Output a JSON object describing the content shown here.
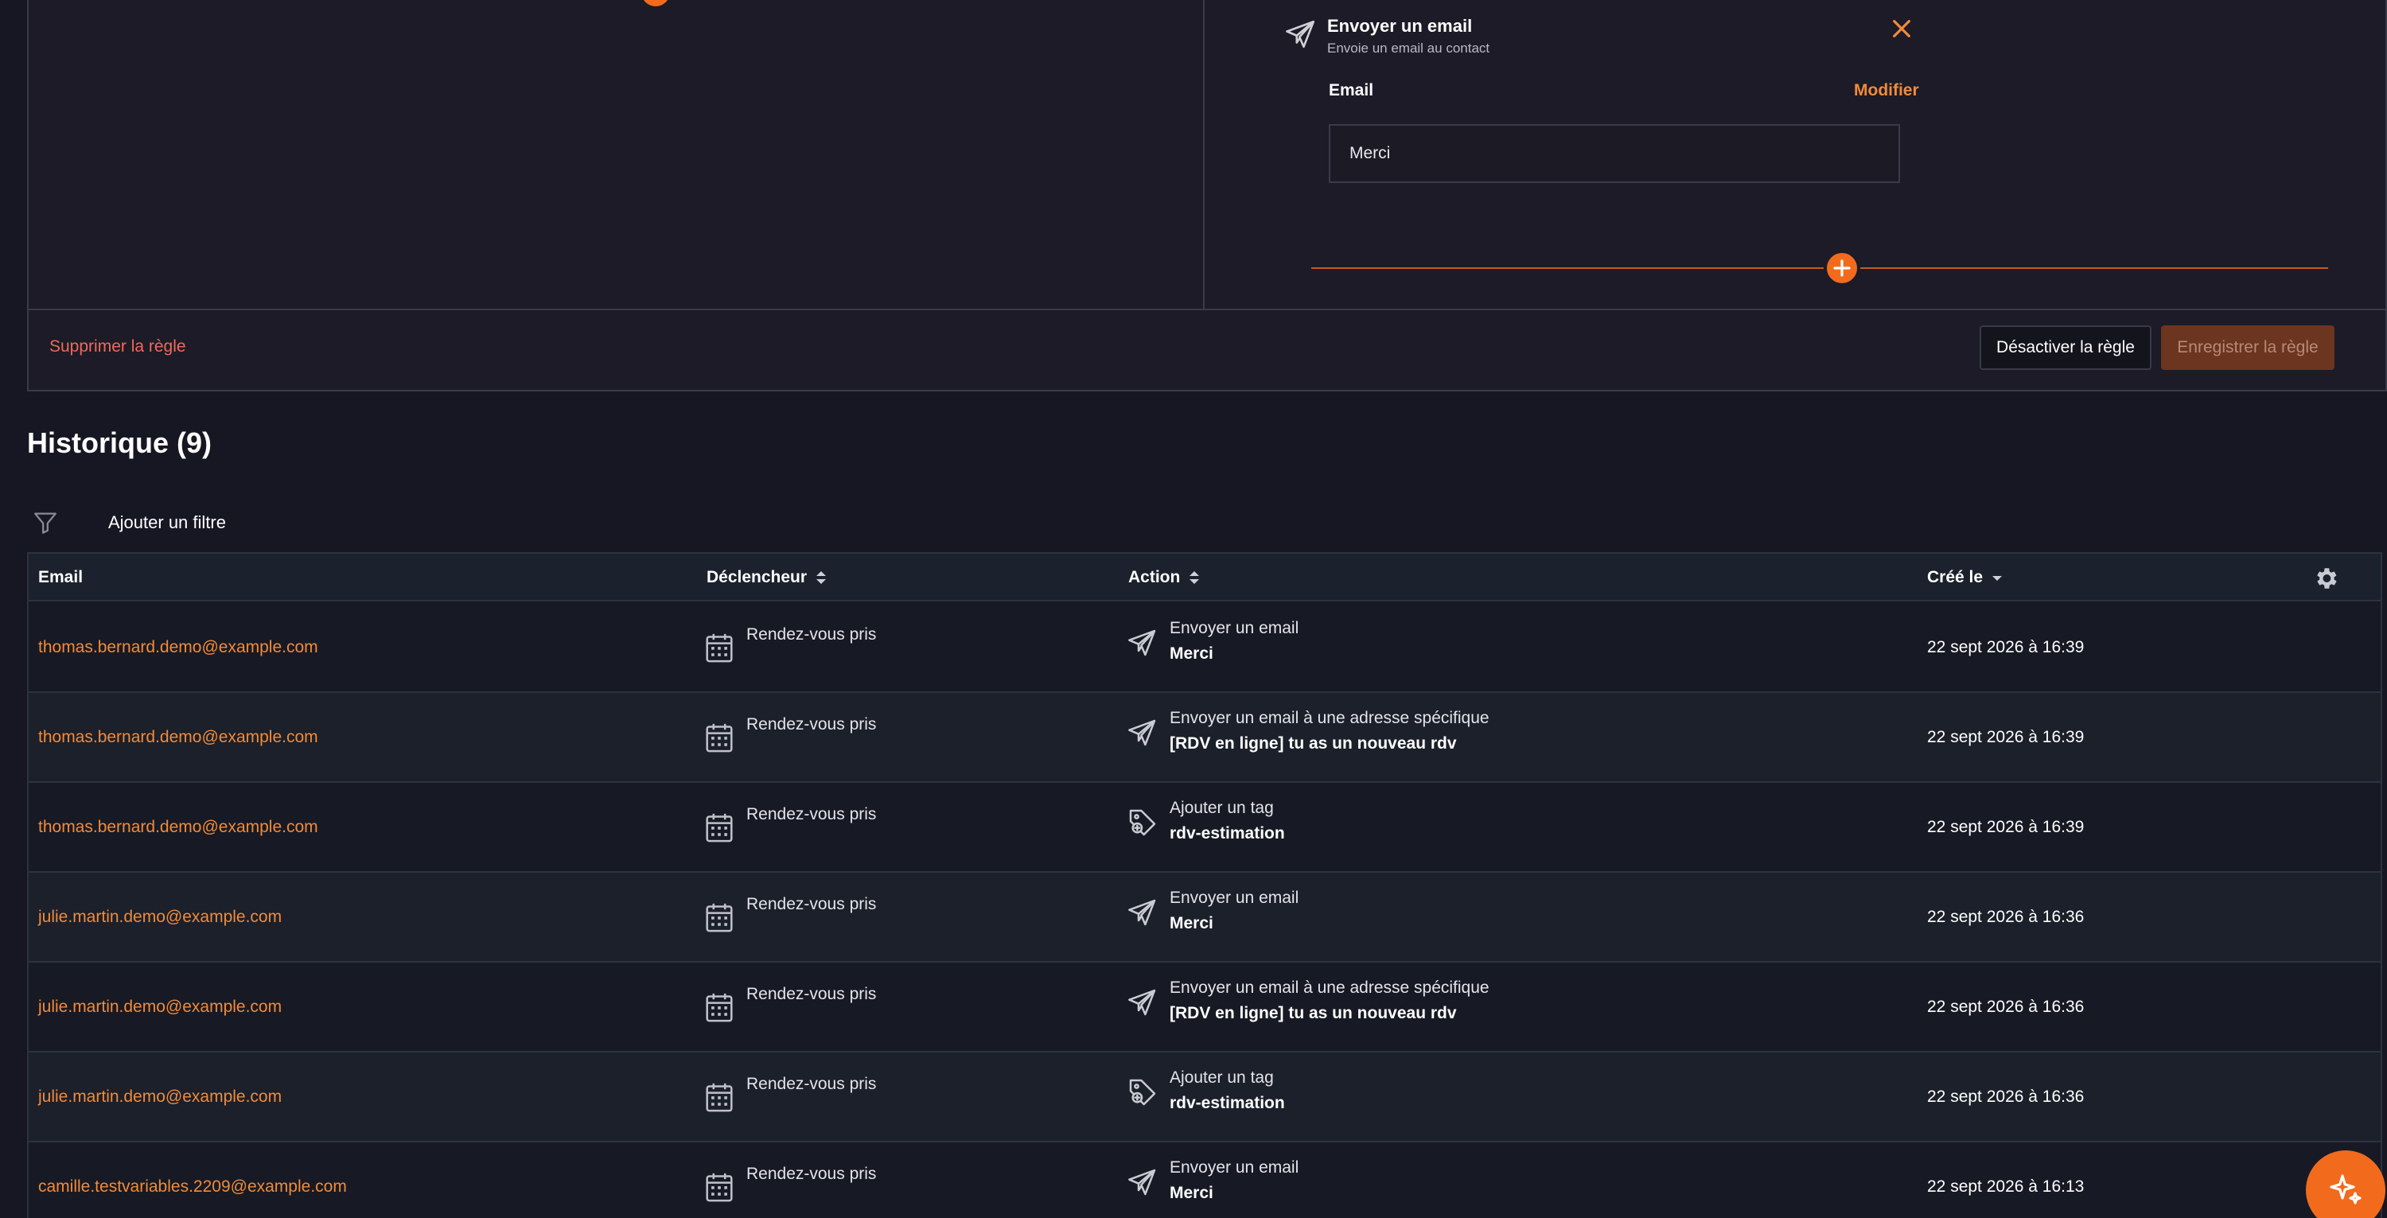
{
  "rule_editor": {
    "action_title": "Envoyer un email",
    "action_subtitle": "Envoie un email au contact",
    "email_label": "Email",
    "modify_label": "Modifier",
    "email_value": "Merci",
    "delete_label": "Supprimer la règle",
    "deactivate_label": "Désactiver la règle",
    "save_label": "Enregistrer la règle"
  },
  "history": {
    "title": "Historique (9)",
    "add_filter_label": "Ajouter un filtre",
    "columns": {
      "email": "Email",
      "trigger": "Déclencheur",
      "action": "Action",
      "created": "Créé le"
    },
    "rows": [
      {
        "email": "thomas.bernard.demo@example.com",
        "trigger": "Rendez-vous pris",
        "action": "Envoyer un email",
        "detail": "Merci",
        "date": "22 sept 2026 à 16:39",
        "icon": "paper-plane-icon"
      },
      {
        "email": "thomas.bernard.demo@example.com",
        "trigger": "Rendez-vous pris",
        "action": "Envoyer un email à une adresse spécifique",
        "detail": "[RDV en ligne] tu as un nouveau rdv",
        "date": "22 sept 2026 à 16:39",
        "icon": "paper-plane-icon"
      },
      {
        "email": "thomas.bernard.demo@example.com",
        "trigger": "Rendez-vous pris",
        "action": "Ajouter un tag",
        "detail": "rdv-estimation",
        "date": "22 sept 2026 à 16:39",
        "icon": "tag-plus-icon"
      },
      {
        "email": "julie.martin.demo@example.com",
        "trigger": "Rendez-vous pris",
        "action": "Envoyer un email",
        "detail": "Merci",
        "date": "22 sept 2026 à 16:36",
        "icon": "paper-plane-icon"
      },
      {
        "email": "julie.martin.demo@example.com",
        "trigger": "Rendez-vous pris",
        "action": "Envoyer un email à une adresse spécifique",
        "detail": "[RDV en ligne] tu as un nouveau rdv",
        "date": "22 sept 2026 à 16:36",
        "icon": "paper-plane-icon"
      },
      {
        "email": "julie.martin.demo@example.com",
        "trigger": "Rendez-vous pris",
        "action": "Ajouter un tag",
        "detail": "rdv-estimation",
        "date": "22 sept 2026 à 16:36",
        "icon": "tag-plus-icon"
      },
      {
        "email": "camille.testvariables.2209@example.com",
        "trigger": "Rendez-vous pris",
        "action": "Envoyer un email",
        "detail": "Merci",
        "date": "22 sept 2026 à 16:13",
        "icon": "paper-plane-icon"
      }
    ]
  },
  "colors": {
    "background": "#171723",
    "accent": "#f26b1d",
    "link": "#f28a3a",
    "danger": "#ef6a5a"
  }
}
